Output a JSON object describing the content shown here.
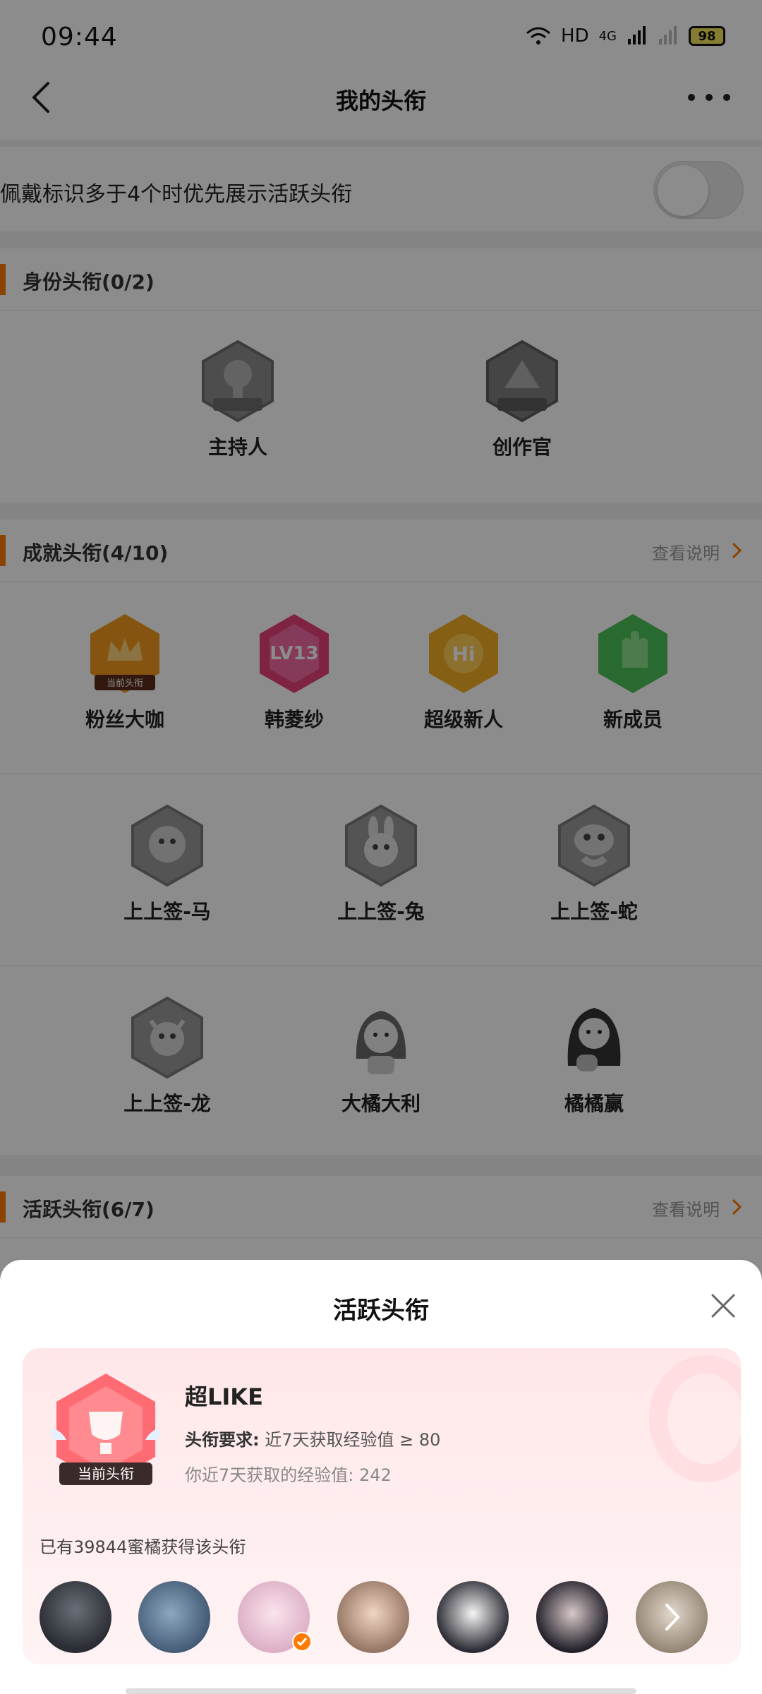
{
  "status": {
    "time": "09:44",
    "network": "HD",
    "signal": "4G",
    "battery": "98"
  },
  "nav": {
    "title": "我的头衔"
  },
  "toggle": {
    "label": "佩戴标识多于4个时优先展示活跃头衔",
    "on": false
  },
  "identity": {
    "title": "身份头衔(0/2)",
    "badges": [
      {
        "name": "主持人",
        "tag": "主持人",
        "icon": "microphone-badge-icon"
      },
      {
        "name": "创作官",
        "tag": "创作官",
        "icon": "creator-badge-icon"
      }
    ]
  },
  "achievement": {
    "title": "成就头衔(4/10)",
    "link": "查看说明",
    "row1": [
      {
        "name": "粉丝大咖",
        "tag": "当前头衔",
        "icon": "crown-badge-icon",
        "color": "#f39a1e"
      },
      {
        "name": "韩菱纱",
        "tag": "LV13",
        "icon": "level-badge-icon",
        "color": "#e8407a"
      },
      {
        "name": "超级新人",
        "tag": "Hi",
        "icon": "hi-badge-icon",
        "color": "#f2b025"
      },
      {
        "name": "新成员",
        "tag": "",
        "icon": "hand-badge-icon",
        "color": "#4cc15a"
      }
    ],
    "row2": [
      {
        "name": "上上签-马",
        "icon": "horse-badge-icon"
      },
      {
        "name": "上上签-兔",
        "icon": "rabbit-badge-icon"
      },
      {
        "name": "上上签-蛇",
        "icon": "snake-badge-icon"
      }
    ],
    "row3": [
      {
        "name": "上上签-龙",
        "icon": "dragon-badge-icon"
      },
      {
        "name": "大橘大利",
        "icon": "girl-avatar-badge-icon"
      },
      {
        "name": "橘橘赢",
        "icon": "girl-dark-badge-icon"
      }
    ]
  },
  "active": {
    "title": "活跃头衔(6/7)",
    "link": "查看说明"
  },
  "sheet": {
    "title": "活跃头衔",
    "badge_tag": "当前头衔",
    "badge_name": "超LIKE",
    "requirement_label": "头衔要求:",
    "requirement_value": "近7天获取经验值 ≥ 80",
    "mine_text": "你近7天获取的经验值: 242",
    "count_text": "已有39844蜜橘获得该头衔",
    "avatars": [
      {
        "name": "avatar-1",
        "color": "#3b3f48"
      },
      {
        "name": "avatar-2",
        "color": "#5e7790"
      },
      {
        "name": "avatar-3",
        "color": "#e8c6d6"
      },
      {
        "name": "avatar-4",
        "color": "#c9a58a"
      },
      {
        "name": "avatar-5",
        "color": "#2e2e36"
      },
      {
        "name": "avatar-6",
        "color": "#2a2630"
      },
      {
        "name": "avatar-7",
        "color": "#a89a8a"
      }
    ]
  }
}
